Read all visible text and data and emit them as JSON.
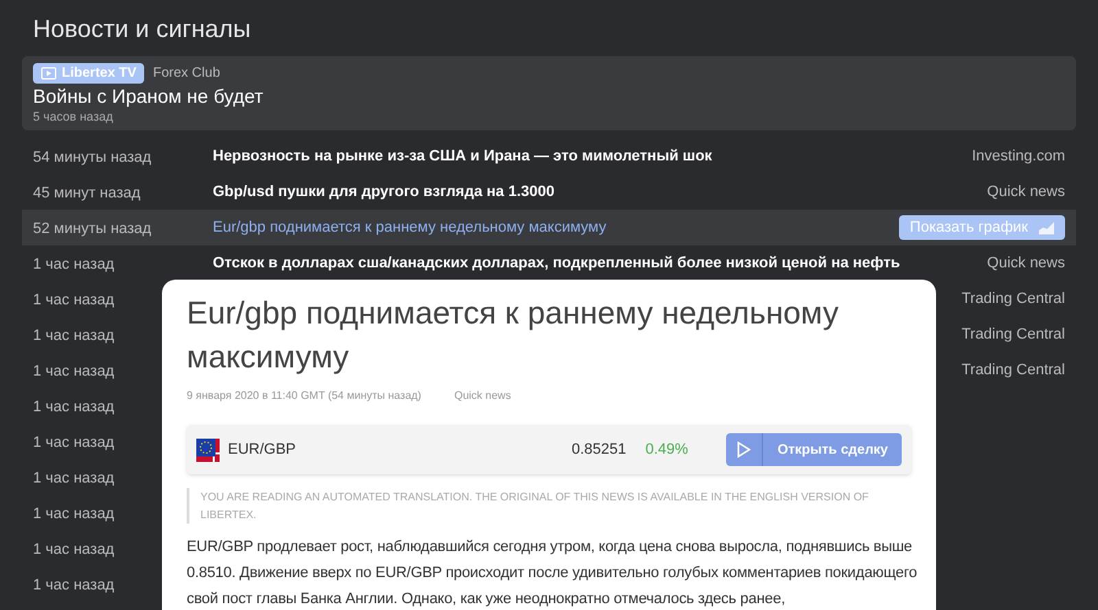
{
  "header": {
    "title": "Новости и сигналы"
  },
  "featured": {
    "badge": "Libertex TV",
    "source": "Forex Club",
    "headline": "Войны с Ираном не будет",
    "time": "5 часов назад"
  },
  "news": [
    {
      "time": "54 минуты назад",
      "title": "Нервозность на рынке из-за США и Ирана — это мимолетный шок",
      "source": "Investing.com",
      "selected": false
    },
    {
      "time": "45 минут назад",
      "title": "Gbp/usd пушки для другого взгляда на 1.3000",
      "source": "Quick news",
      "selected": false
    },
    {
      "time": "52 минуты назад",
      "title": "Eur/gbp поднимается к раннему недельному максимуму",
      "action": "Показать график",
      "selected": true
    },
    {
      "time": "1 час назад",
      "title": "Отскок в долларах сша/канадских долларах, подкрепленный более низкой ценой на нефть",
      "source": "Quick news",
      "selected": false
    },
    {
      "time": "1 час назад",
      "source": "Trading Central",
      "selected": false
    },
    {
      "time": "1 час назад",
      "source": "Trading Central",
      "selected": false
    },
    {
      "time": "1 час назад",
      "source": "Trading Central",
      "selected": false
    },
    {
      "time": "1 час назад",
      "selected": false
    },
    {
      "time": "1 час назад",
      "selected": false
    },
    {
      "time": "1 час назад",
      "selected": false
    },
    {
      "time": "1 час назад",
      "selected": false
    },
    {
      "time": "1 час назад",
      "selected": false
    },
    {
      "time": "1 час назад",
      "selected": false
    }
  ],
  "article": {
    "title": "Eur/gbp поднимается к раннему недельному максимуму",
    "date": "9 января 2020 в 11:40 GMT",
    "ago": "(54 минуты назад)",
    "source": "Quick news",
    "instrument": {
      "symbol": "EUR/GBP",
      "price": "0.85251",
      "change": "0.49%"
    },
    "trade_button": "Открыть сделку",
    "notice": "YOU ARE READING AN AUTOMATED TRANSLATION. THE ORIGINAL OF THIS NEWS IS AVAILABLE IN THE ENGLISH VERSION OF LIBERTEX.",
    "body": "EUR/GBP продлевает рост, наблюдавшийся сегодня утром, когда цена снова выросла, поднявшись выше 0.8510. Движение вверх по EUR/GBP происходит после удивительно голубых комментариев покидающего свой пост главы Банка Англии. Однако, как уже неоднократно отмечалось здесь ранее,"
  }
}
